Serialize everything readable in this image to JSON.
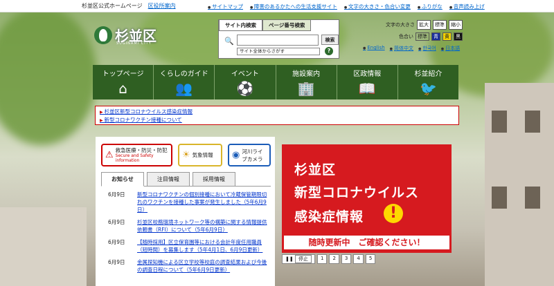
{
  "topbar": {
    "site_name": "杉並区公式ホームページ",
    "map_link": "区役所案内",
    "links": [
      "サイトマップ",
      "障害のあるかたへの生活支援サイト",
      "文字の大きさ・色合い変更",
      "ふりがな",
      "音声読み上げ"
    ]
  },
  "logo": {
    "name": "杉並区",
    "sub": "SUGINAMI CITY"
  },
  "search": {
    "tab_site": "サイト内検索",
    "tab_page": "ページ番号検索",
    "button": "検索",
    "scope": "サイト全体からさがす",
    "help": "?"
  },
  "util": {
    "text_size_label": "文字の大きさ",
    "text_size_buttons": [
      "拡大",
      "標準",
      "縮小"
    ],
    "color_label": "色合い",
    "color_buttons": [
      {
        "label": "標準",
        "bg": "#ffffff",
        "fg": "#000000"
      },
      {
        "label": "青",
        "bg": "#1a2f9a",
        "fg": "#ffffff"
      },
      {
        "label": "黄",
        "bg": "#f5d300",
        "fg": "#000000"
      },
      {
        "label": "黒",
        "bg": "#111111",
        "fg": "#ffffff"
      }
    ]
  },
  "languages": [
    "English",
    "简体中文",
    "한국어",
    "日本語"
  ],
  "nav": [
    {
      "label": "トップページ",
      "icon": "home-icon",
      "glyph": "⌂"
    },
    {
      "label": "くらしのガイド",
      "icon": "people-icon",
      "glyph": "👥"
    },
    {
      "label": "イベント",
      "icon": "event-icon",
      "glyph": "⚽"
    },
    {
      "label": "施設案内",
      "icon": "facility-icon",
      "glyph": "🏢"
    },
    {
      "label": "区政情報",
      "icon": "book-icon",
      "glyph": "📖"
    },
    {
      "label": "杉並紹介",
      "icon": "bird-icon",
      "glyph": "🐦"
    }
  ],
  "notices": [
    "杉並区新型コロナウイルス感染症情報",
    "新型コロナワクチン接種について"
  ],
  "quick": {
    "emergency": "救急医療・防災・防犯",
    "emergency_en": "Secure and Safety information",
    "weather": "気象情報",
    "camera": "河川ライブカメラ"
  },
  "news_tabs": [
    "お知らせ",
    "注目情報",
    "採用情報"
  ],
  "news": [
    {
      "date": "6月9日",
      "text": "新型コロナワクチンの個別接種において冷蔵保管期限切れのワクチンを接種した事案が発生しました（5年6月9日）"
    },
    {
      "date": "6月9日",
      "text": "杉並区校務環境ネットワーク等の構築に関する情報提供依頼書（RFI）について（5年6月9日）"
    },
    {
      "date": "6月9日",
      "text": "【随時採用】区立保育園等における会計年度任用職員（短時間）を募集します（5年4月1日、6月9日更新）"
    },
    {
      "date": "6月9日",
      "text": "金属探知機による区立学校等校庭の調査結果および今後の調査日程について（5年6月9日更新）"
    }
  ],
  "banner": {
    "line1": "杉並区",
    "line2": "新型コロナウイルス",
    "line3": "感染症情報",
    "mark": "!",
    "strip": "随時更新中　ご確認ください！"
  },
  "pager": [
    "停止",
    "1",
    "2",
    "3",
    "4",
    "5"
  ]
}
